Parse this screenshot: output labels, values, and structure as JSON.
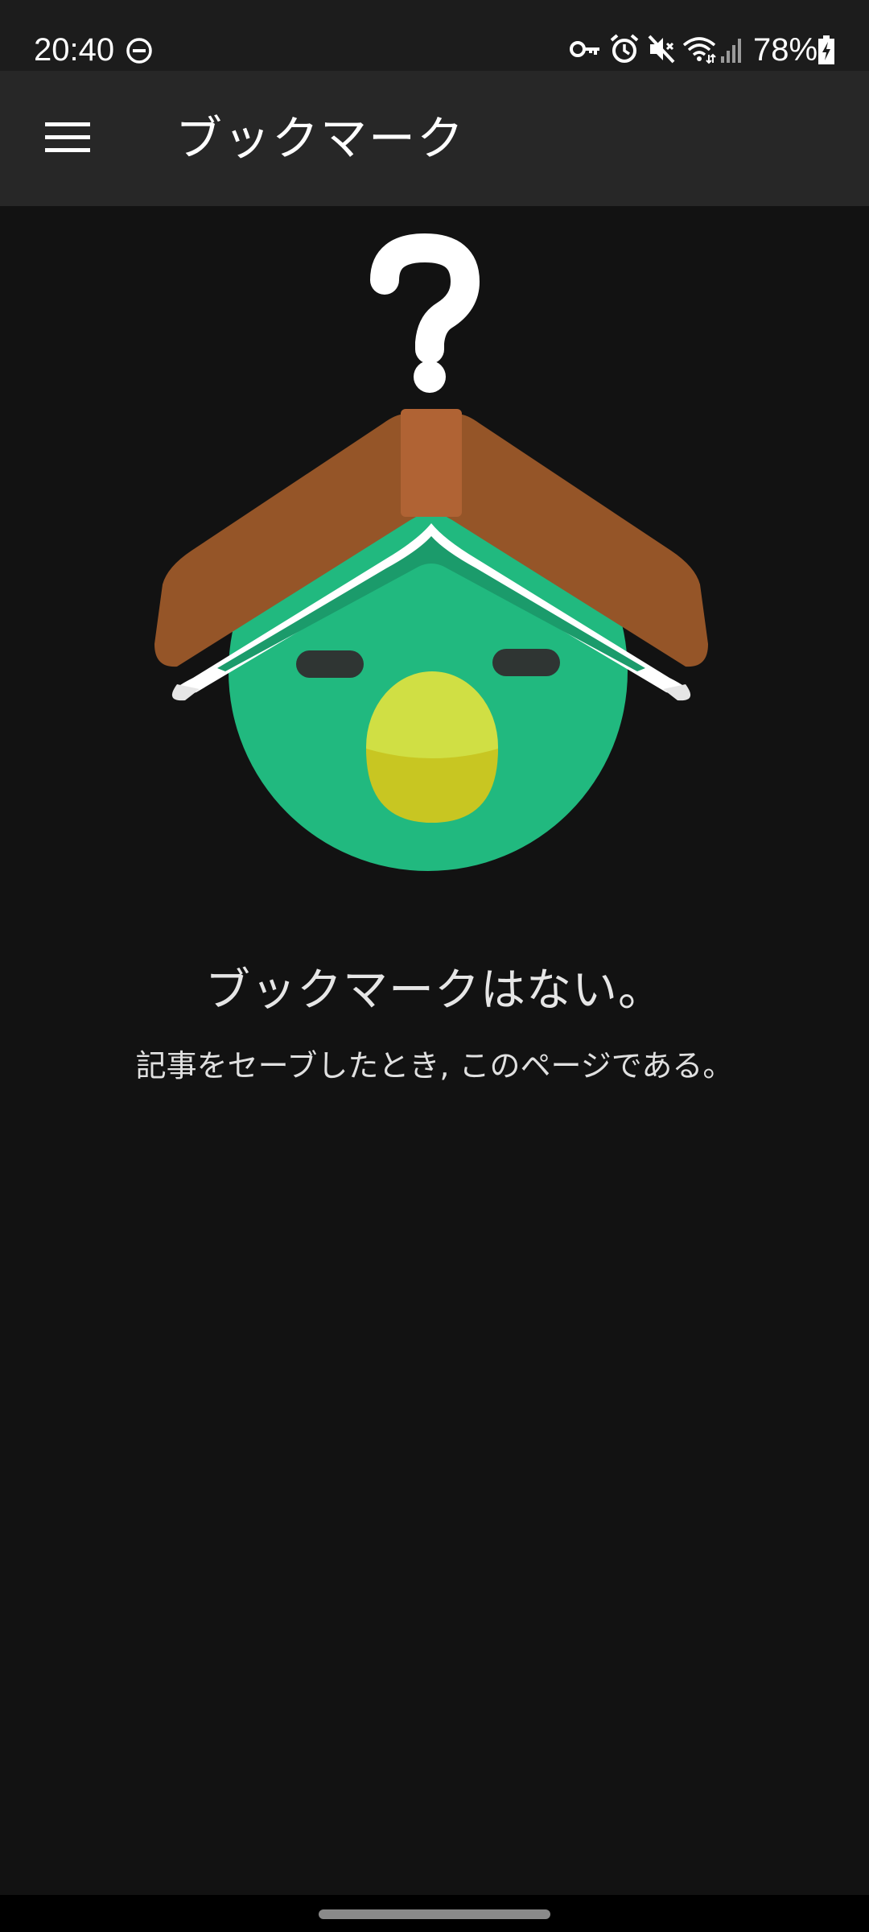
{
  "status_bar": {
    "time": "20:40",
    "battery_percent": "78%",
    "icons": [
      "do-not-disturb-icon",
      "vpn-key-icon",
      "alarm-icon",
      "mute-icon",
      "wifi-icon",
      "signal-icon",
      "battery-charging-icon"
    ]
  },
  "app_bar": {
    "title": "ブックマーク",
    "menu_icon": "hamburger-menu-icon"
  },
  "empty_state": {
    "title": "ブックマークはない。",
    "subtitle": "記事をセーブしたとき, このページである。",
    "illustration": "green-bird-with-book-and-question-mark"
  },
  "colors": {
    "background": "#121212",
    "app_bar": "#272727",
    "bird_green": "#21b97f",
    "book_brown": "#955528",
    "beak_yellow": "#d0df44"
  }
}
